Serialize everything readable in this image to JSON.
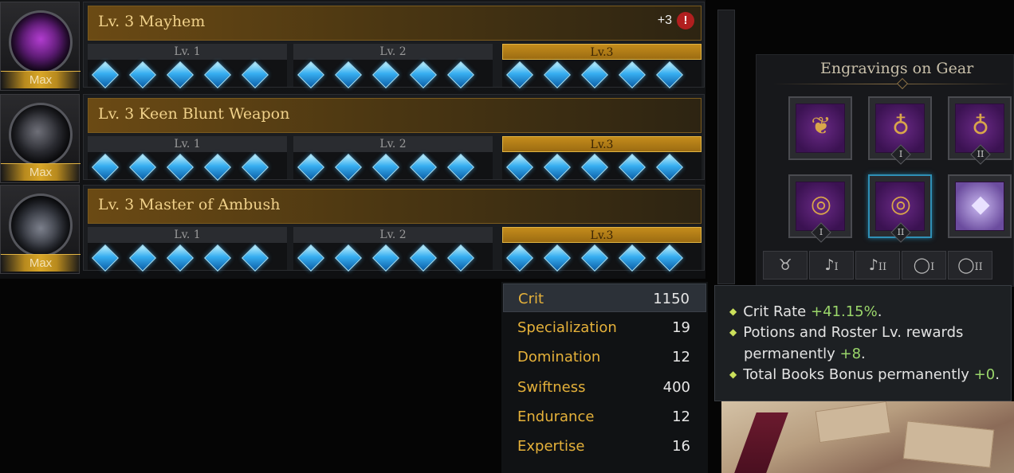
{
  "engravings": [
    {
      "title": "Lv. 3 Mayhem",
      "badge": "Max",
      "extra": "+3",
      "alert": "!",
      "levels": [
        "Lv. 1",
        "Lv. 2",
        "Lv.3"
      ]
    },
    {
      "title": "Lv. 3 Keen Blunt Weapon",
      "badge": "Max",
      "levels": [
        "Lv. 1",
        "Lv. 2",
        "Lv.3"
      ]
    },
    {
      "title": "Lv. 3 Master of Ambush",
      "badge": "Max",
      "levels": [
        "Lv. 1",
        "Lv. 2",
        "Lv.3"
      ]
    }
  ],
  "gear_panel": {
    "title": "Engravings on Gear",
    "slots": [
      {
        "item": "necklace-icon",
        "tier": ""
      },
      {
        "item": "earring-icon",
        "tier": "I"
      },
      {
        "item": "earring-icon",
        "tier": "II"
      },
      {
        "item": "ring-icon",
        "tier": "I"
      },
      {
        "item": "ring-icon",
        "tier": "II"
      },
      {
        "item": "crystal-stone-icon",
        "tier": ""
      }
    ],
    "tabs": [
      {
        "icon": "necklace-icon",
        "tier": ""
      },
      {
        "icon": "earring-icon",
        "tier": "I"
      },
      {
        "icon": "earring-icon",
        "tier": "II"
      },
      {
        "icon": "ring-icon",
        "tier": "I"
      },
      {
        "icon": "ring-icon",
        "tier": "II"
      }
    ]
  },
  "stats": [
    {
      "name": "Crit",
      "value": "1150"
    },
    {
      "name": "Specialization",
      "value": "19"
    },
    {
      "name": "Domination",
      "value": "12"
    },
    {
      "name": "Swiftness",
      "value": "400"
    },
    {
      "name": "Endurance",
      "value": "12"
    },
    {
      "name": "Expertise",
      "value": "16"
    }
  ],
  "tooltip": {
    "line1_label": "Crit Rate ",
    "line1_value": "+41.15%",
    "line1_end": ".",
    "line2_label": "Potions and Roster Lv. rewards",
    "line2_cont": "permanently ",
    "line2_value": "+8",
    "line2_end": ".",
    "line3_label": "Total Books Bonus permanently ",
    "line3_value": "+0",
    "line3_end": "."
  },
  "colors": {
    "accent_gold": "#f0d18a",
    "stat_label": "#e5b13a",
    "positive_green": "#9ad66a",
    "gem_blue": "#37aef0"
  }
}
